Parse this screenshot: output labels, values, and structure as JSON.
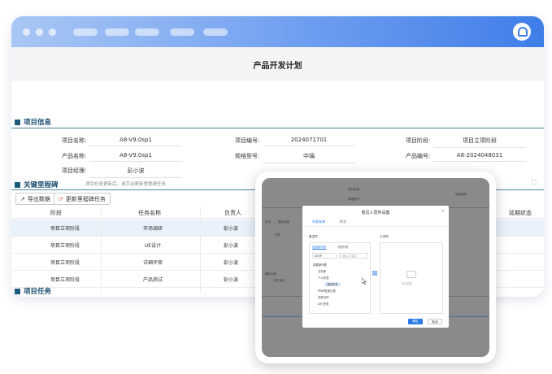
{
  "page": {
    "title": "产品开发计划"
  },
  "project_info": {
    "heading": "项目信息",
    "fields": [
      {
        "label": "项目名称:",
        "value": "A8-V9.0sp1"
      },
      {
        "label": "项目编号:",
        "value": "2024071701"
      },
      {
        "label": "项目阶段:",
        "value": "项目立项阶段"
      },
      {
        "label": "产品名称:",
        "value": "A8-V9.0sp1"
      },
      {
        "label": "规格型号:",
        "value": "中端"
      },
      {
        "label": "产品编号:",
        "value": "A8-2024048031"
      },
      {
        "label": "项目经理:",
        "value": "彭小波"
      }
    ]
  },
  "milestones": {
    "heading": "关键里程碑",
    "hint": "项目任务更新后，请手动更新里程碑任务",
    "export_label": "导出数据",
    "update_label": "更新里程碑任务",
    "columns": [
      "阶段",
      "任务名称",
      "负责人",
      "延期状态"
    ],
    "rows": [
      {
        "stage": "项目立项阶段",
        "task": "市场调研",
        "owner": "彭小波"
      },
      {
        "stage": "项目立项阶段",
        "task": "UE设计",
        "owner": "彭小波"
      },
      {
        "stage": "项目立项阶段",
        "task": "详细评审",
        "owner": "彭小波"
      },
      {
        "stage": "项目立项阶段",
        "task": "产品测试",
        "owner": "彭小波"
      }
    ]
  },
  "tasks": {
    "heading": "项目任务"
  },
  "dialog": {
    "title": "意见人员件设置",
    "tab_active": "列表来源",
    "tab_other": "样式",
    "left_label": "备选项",
    "left_tab_active": "发展报列表",
    "left_tab_other": "流程列表",
    "scope": "ATGP",
    "search_placeholder": "请输入关键字",
    "tree": [
      "发展报列表",
      "文件库",
      "个人任务",
      "我的任务",
      "PPAP批准记录",
      "任务文件",
      "DFL任务"
    ],
    "right_label": "已选项",
    "empty_text": "暂无数据",
    "ok_label": "确定",
    "cancel_label": "取消",
    "bg_labels": [
      "项目名称",
      "规格型号",
      "项目编号",
      "导出",
      "删除全部",
      "任务",
      "文件名称",
      "删除全部"
    ]
  },
  "colors": {
    "accent": "#3f7ee8",
    "section": "#1b5b7a",
    "primary_button": "#2d7be6"
  }
}
